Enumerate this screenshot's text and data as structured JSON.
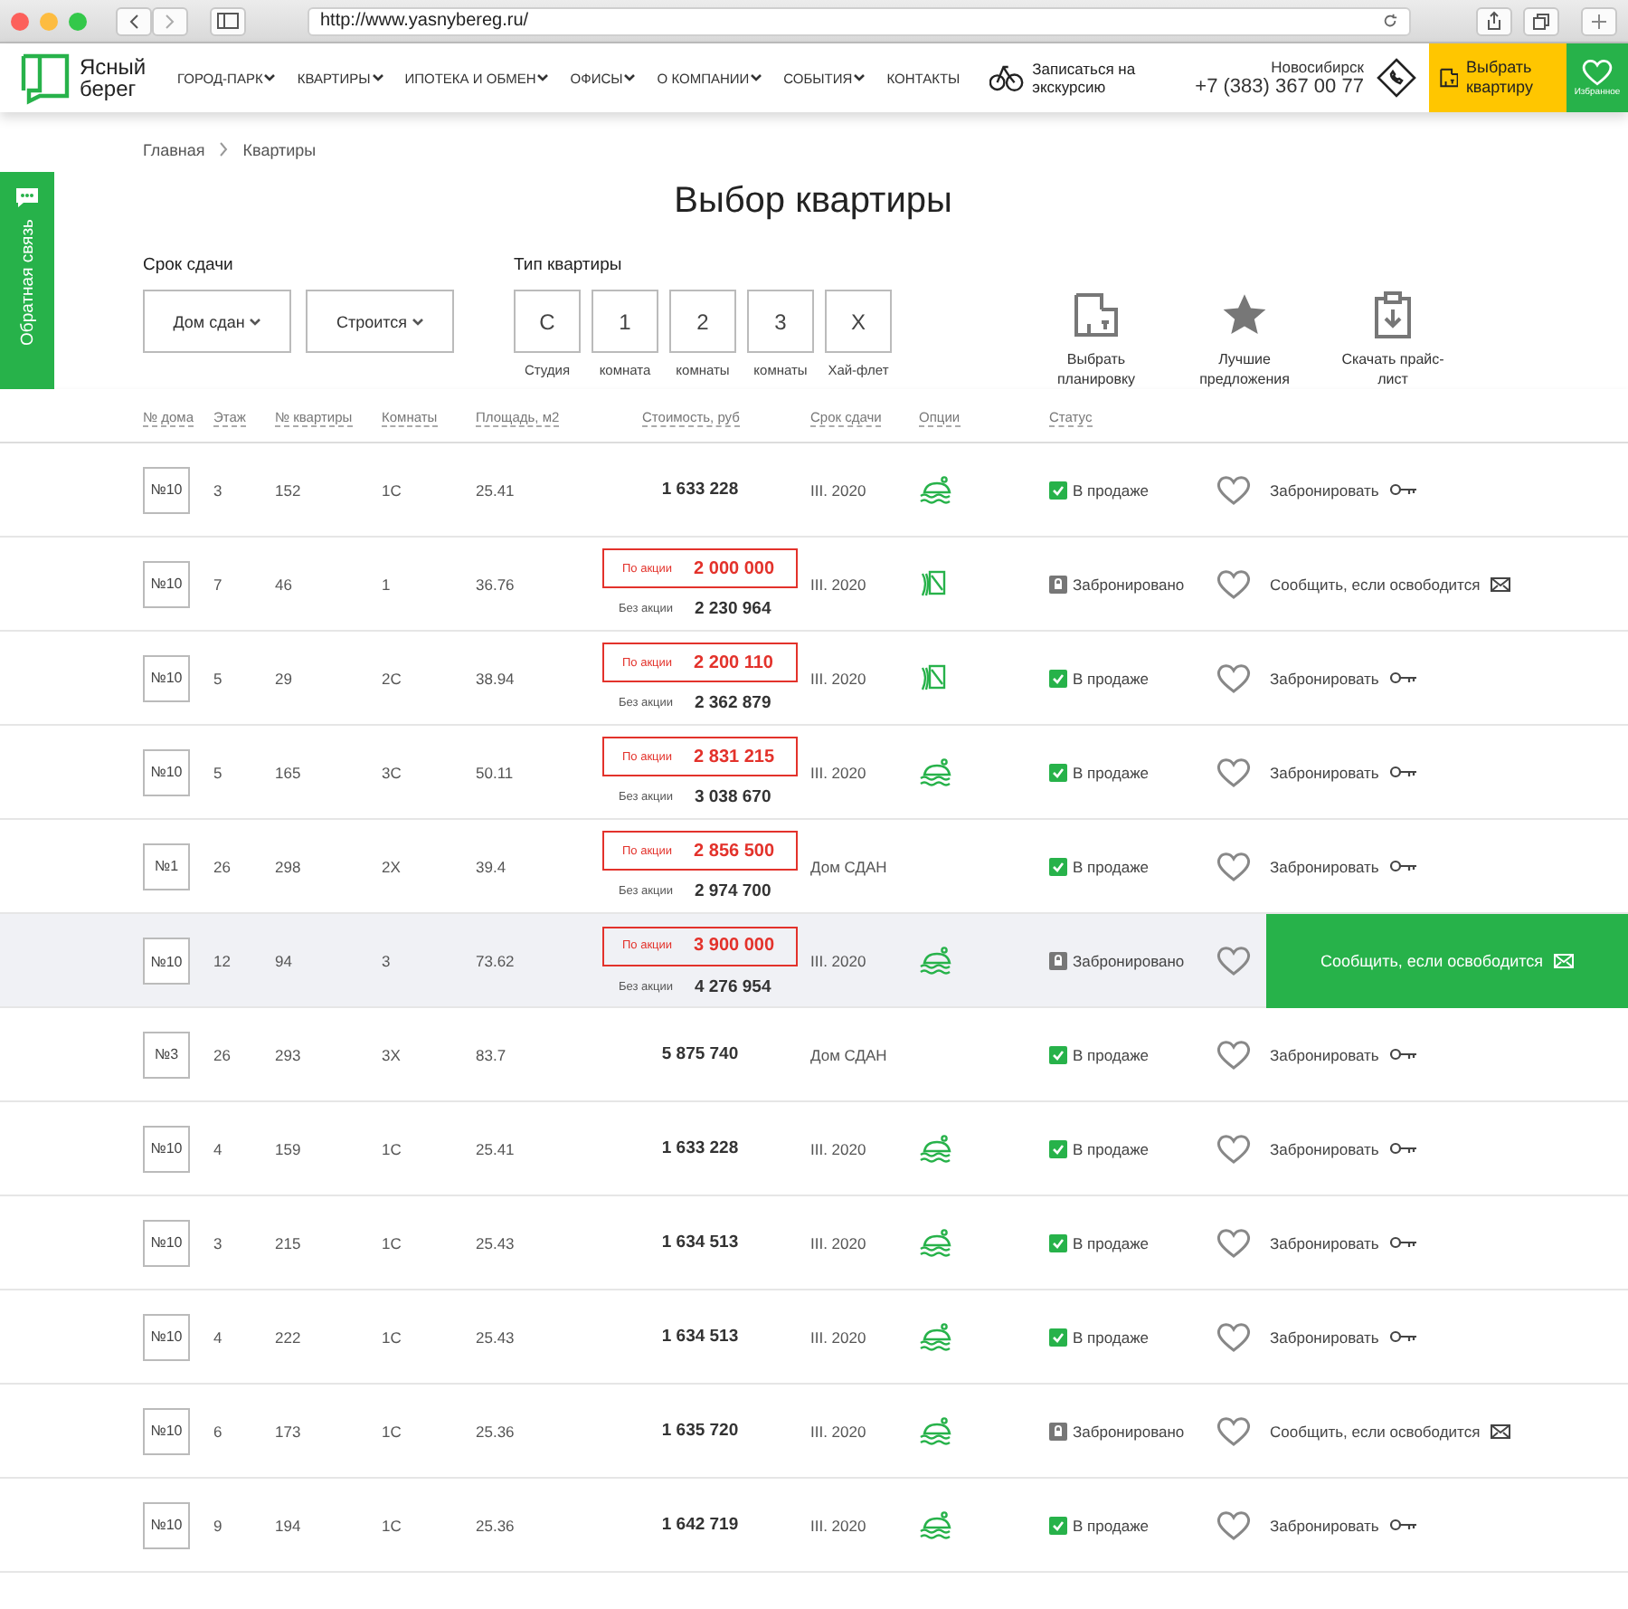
{
  "browser": {
    "url": "http://www.yasnybereg.ru/"
  },
  "header": {
    "logo": "Ясный берег",
    "nav": [
      {
        "label": "ГОРОД-ПАРК",
        "dropdown": true
      },
      {
        "label": "КВАРТИРЫ",
        "dropdown": true
      },
      {
        "label": "ИПОТЕКА И ОБМЕН",
        "dropdown": true
      },
      {
        "label": "ОФИСЫ",
        "dropdown": true
      },
      {
        "label": "О КОМПАНИИ",
        "dropdown": true
      },
      {
        "label": "СОБЫТИЯ",
        "dropdown": true
      },
      {
        "label": "КОНТАКТЫ",
        "dropdown": false
      }
    ],
    "tour": "Записаться на экскурсию",
    "city": "Новосибирск",
    "phone": "+7 (383) 367 00 77",
    "choose": "Выбрать квартиру",
    "favorites": "Избранное"
  },
  "feedback_tab": "Обратная связь",
  "breadcrumbs": [
    "Главная",
    "Квартиры"
  ],
  "title": "Выбор квартиры",
  "filters": {
    "term_label": "Срок сдачи",
    "term_options": [
      "Дом сдан",
      "Строится"
    ],
    "type_label": "Тип квартиры",
    "types": [
      {
        "letter": "С",
        "caption": "Студия"
      },
      {
        "letter": "1",
        "caption": "комната"
      },
      {
        "letter": "2",
        "caption": "комнаты"
      },
      {
        "letter": "3",
        "caption": "комнаты"
      },
      {
        "letter": "Х",
        "caption": "Хай-флет"
      }
    ]
  },
  "quick_actions": [
    {
      "kind": "plan",
      "label": "Выбрать планировку"
    },
    {
      "kind": "star",
      "label": "Лучшие предложения"
    },
    {
      "kind": "download",
      "label": "Скачать прайс-лист"
    }
  ],
  "table": {
    "columns": [
      "№ дома",
      "Этаж",
      "№ квартиры",
      "Комнаты",
      "Площадь, м2",
      "Стоимость, руб",
      "Срок сдачи",
      "Опции",
      "Статус"
    ],
    "rows": [
      {
        "house": "№10",
        "floor": "3",
        "apartment": "152",
        "rooms": "1С",
        "area": "25.41",
        "price": "1 633 228",
        "term": "III. 2020",
        "option": {
          "kind": "car"
        },
        "status": {
          "kind": "sale",
          "label": "В продаже"
        },
        "action": "Забронировать",
        "selected": false
      },
      {
        "house": "№10",
        "floor": "7",
        "apartment": "46",
        "rooms": "1",
        "area": "36.76",
        "promo_label": "По акции",
        "promo_price": "2 000 000",
        "regular_label": "Без акции",
        "price": "2 230 964",
        "term": "III. 2020",
        "option": {
          "kind": "window"
        },
        "status": {
          "kind": "booked",
          "label": "Забронировано"
        },
        "action": "Сообщить, если освободится",
        "selected": false
      },
      {
        "house": "№10",
        "floor": "5",
        "apartment": "29",
        "rooms": "2С",
        "area": "38.94",
        "promo_label": "По акции",
        "promo_price": "2 200 110",
        "regular_label": "Без акции",
        "price": "2 362 879",
        "term": "III. 2020",
        "option": {
          "kind": "window"
        },
        "status": {
          "kind": "sale",
          "label": "В продаже"
        },
        "action": "Забронировать",
        "selected": false
      },
      {
        "house": "№10",
        "floor": "5",
        "apartment": "165",
        "rooms": "3С",
        "area": "50.11",
        "promo_label": "По акции",
        "promo_price": "2 831 215",
        "regular_label": "Без акции",
        "price": "3 038 670",
        "term": "III. 2020",
        "option": {
          "kind": "car"
        },
        "status": {
          "kind": "sale",
          "label": "В продаже"
        },
        "action": "Забронировать",
        "selected": false
      },
      {
        "house": "№1",
        "floor": "26",
        "apartment": "298",
        "rooms": "2Х",
        "area": "39.4",
        "promo_label": "По акции",
        "promo_price": "2 856 500",
        "regular_label": "Без акции",
        "price": "2 974 700",
        "term": "Дом СДАН",
        "status": {
          "kind": "sale",
          "label": "В продаже"
        },
        "action": "Забронировать",
        "selected": false
      },
      {
        "house": "№10",
        "floor": "12",
        "apartment": "94",
        "rooms": "3",
        "area": "73.62",
        "promo_label": "По акции",
        "promo_price": "3 900 000",
        "regular_label": "Без акции",
        "price": "4 276 954",
        "term": "III. 2020",
        "option": {
          "kind": "car"
        },
        "status": {
          "kind": "booked",
          "label": "Забронировано"
        },
        "action": "Сообщить, если освободится",
        "selected": true
      },
      {
        "house": "№3",
        "floor": "26",
        "apartment": "293",
        "rooms": "3Х",
        "area": "83.7",
        "price": "5 875 740",
        "term": "Дом СДАН",
        "status": {
          "kind": "sale",
          "label": "В продаже"
        },
        "action": "Забронировать",
        "selected": false
      },
      {
        "house": "№10",
        "floor": "4",
        "apartment": "159",
        "rooms": "1С",
        "area": "25.41",
        "price": "1 633 228",
        "term": "III. 2020",
        "option": {
          "kind": "car"
        },
        "status": {
          "kind": "sale",
          "label": "В продаже"
        },
        "action": "Забронировать",
        "selected": false
      },
      {
        "house": "№10",
        "floor": "3",
        "apartment": "215",
        "rooms": "1С",
        "area": "25.43",
        "price": "1 634 513",
        "term": "III. 2020",
        "option": {
          "kind": "car"
        },
        "status": {
          "kind": "sale",
          "label": "В продаже"
        },
        "action": "Забронировать",
        "selected": false
      },
      {
        "house": "№10",
        "floor": "4",
        "apartment": "222",
        "rooms": "1С",
        "area": "25.43",
        "price": "1 634 513",
        "term": "III. 2020",
        "option": {
          "kind": "car"
        },
        "status": {
          "kind": "sale",
          "label": "В продаже"
        },
        "action": "Забронировать",
        "selected": false
      },
      {
        "house": "№10",
        "floor": "6",
        "apartment": "173",
        "rooms": "1С",
        "area": "25.36",
        "price": "1 635 720",
        "term": "III. 2020",
        "option": {
          "kind": "car"
        },
        "status": {
          "kind": "booked",
          "label": "Забронировано"
        },
        "action": "Сообщить, если освободится",
        "selected": false
      },
      {
        "house": "№10",
        "floor": "9",
        "apartment": "194",
        "rooms": "1С",
        "area": "25.36",
        "price": "1 642 719",
        "term": "III. 2020",
        "option": {
          "kind": "car"
        },
        "status": {
          "kind": "sale",
          "label": "В продаже"
        },
        "action": "Забронировать",
        "selected": false
      }
    ]
  }
}
